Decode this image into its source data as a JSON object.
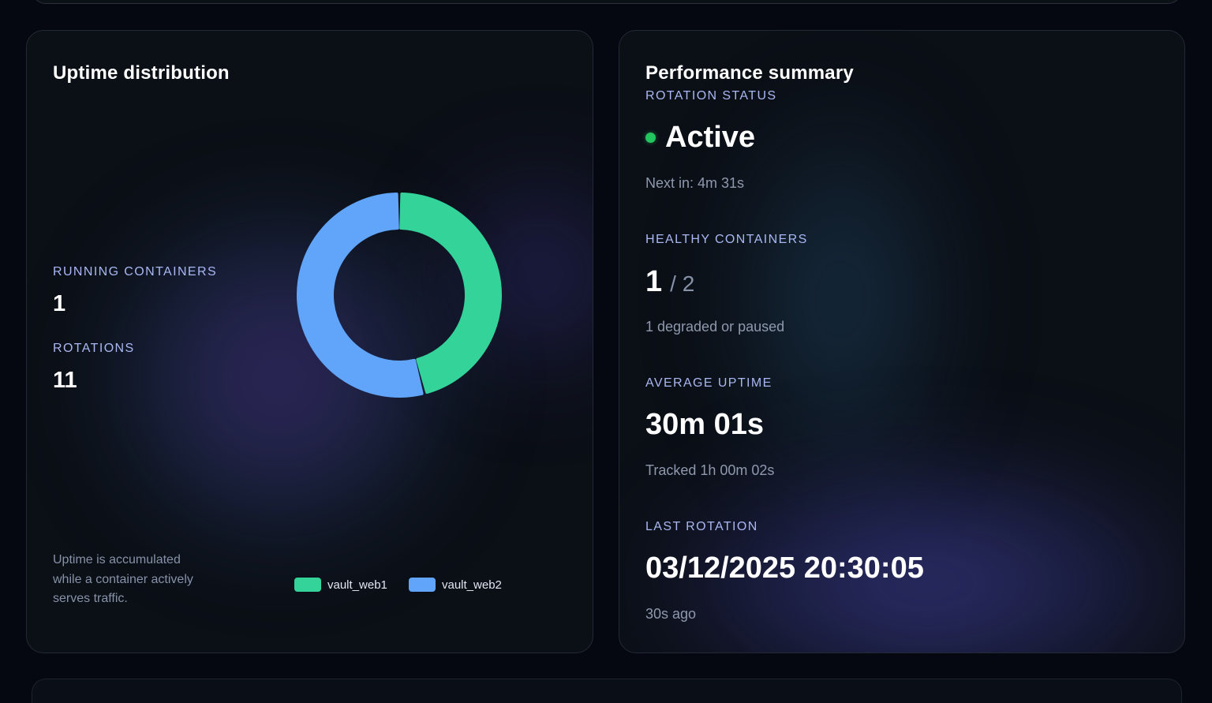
{
  "uptime": {
    "title": "Uptime distribution",
    "running_label": "RUNNING CONTAINERS",
    "running_value": "1",
    "rotations_label": "ROTATIONS",
    "rotations_value": "11",
    "note": "Uptime is accumulated while a container actively serves traffic.",
    "chart_data": {
      "type": "pie",
      "series": [
        {
          "name": "vault_web1",
          "values": [
            0.46
          ]
        },
        {
          "name": "vault_web2",
          "values": [
            0.54
          ]
        }
      ],
      "colors": [
        "#34d399",
        "#60a5fa"
      ],
      "legend_position": "bottom"
    }
  },
  "performance": {
    "title": "Performance summary",
    "rotation_status_label": "ROTATION STATUS",
    "status_value": "Active",
    "status_color": "#22c55e",
    "next_in": "Next in: 4m 31s",
    "healthy_label": "HEALTHY CONTAINERS",
    "healthy_value": "1",
    "healthy_total": "/ 2",
    "degraded_text": "1 degraded or paused",
    "avg_uptime_label": "AVERAGE UPTIME",
    "avg_uptime_value": "30m 01s",
    "tracked_text": "Tracked 1h 00m 02s",
    "last_rotation_label": "LAST ROTATION",
    "last_rotation_value": "03/12/2025 20:30:05",
    "last_rotation_ago": "30s ago"
  }
}
